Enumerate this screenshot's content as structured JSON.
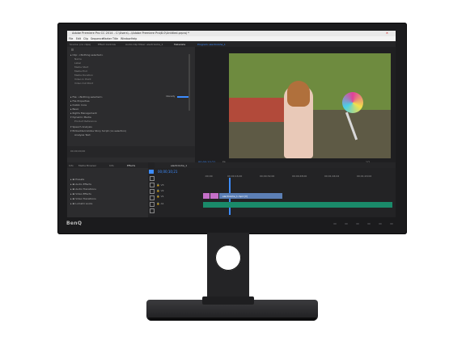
{
  "monitor": {
    "brand": "BenQ"
  },
  "window": {
    "title": "Adobe Premiere Pro CC 2014 - C:\\Users\\...\\Adobe Premiere Pro\\8.0\\Untitled.prproj *"
  },
  "menu": [
    "File",
    "Edit",
    "Clip",
    "Sequence",
    "Marker",
    "Title",
    "Window",
    "Help"
  ],
  "metadata_panel": {
    "tabs": [
      "Source: (no clips)",
      "Effect Controls",
      "Audio Clip Mixer: electroloha_1",
      "Metadata"
    ],
    "active_tab": "Metadata",
    "rows": [
      {
        "label": "Clip: <Nothing selected>",
        "level": "head"
      },
      {
        "label": "Name",
        "level": "sub"
      },
      {
        "label": "Label",
        "level": "sub"
      },
      {
        "label": "Media Start",
        "level": "sub"
      },
      {
        "label": "Media End",
        "level": "sub"
      },
      {
        "label": "Media Duration",
        "level": "sub"
      },
      {
        "label": "Video In Point",
        "level": "sub"
      },
      {
        "label": "Video Out Point",
        "level": "sub"
      },
      {
        "label": "File: <Nothing selected>",
        "level": "head"
      },
      {
        "label": "File Properties",
        "level": "head"
      },
      {
        "label": "Dublin Core",
        "level": "head"
      },
      {
        "label": "Basic",
        "level": "head"
      },
      {
        "label": "Rights Management",
        "level": "head"
      },
      {
        "label": "Dynamic Media",
        "level": "head"
      },
      {
        "label": "Product Reference",
        "level": "sub"
      },
      {
        "label": "Speech Analysis",
        "level": "head"
      },
      {
        "label": "Embedded Adobe Story Script (no selection)",
        "level": "head"
      },
      {
        "label": "Analysis Text:",
        "level": "head"
      }
    ],
    "intensity_label": "Intensity",
    "timecode": "00;00;00;00"
  },
  "program_monitor": {
    "tab": "Program: electroloha_1",
    "timecode_left": "00;00;10;21",
    "fit": "Fit",
    "zoom": "1/2"
  },
  "effects_panel": {
    "tabs": [
      "Info",
      "Media Browser",
      "Info",
      "Effects"
    ],
    "active_tab": "Effects",
    "items": [
      "Presets",
      "Audio Effects",
      "Audio Transitions",
      "Video Effects",
      "Video Transitions",
      "Lumetri Looks"
    ]
  },
  "timeline": {
    "tab": "electroloha_1",
    "timecode": "00;00;10;21",
    "ruler": [
      ":00;00",
      "00;00;16;00",
      "00;00;32;00",
      "00;00;48;00",
      "00;01;04;02",
      "00;01;20;02",
      "00;01;36;02"
    ],
    "tracks": [
      {
        "name": "V3"
      },
      {
        "name": "V2"
      },
      {
        "name": "V1",
        "clip": "electroloha_1.mp4 [V]"
      },
      {
        "name": "A1"
      }
    ]
  },
  "colors": {
    "accent": "#3d8cff",
    "clip_video": "#5c7fb5",
    "clip_fx": "#c46fc8",
    "clip_audio": "#1a8a6a"
  }
}
